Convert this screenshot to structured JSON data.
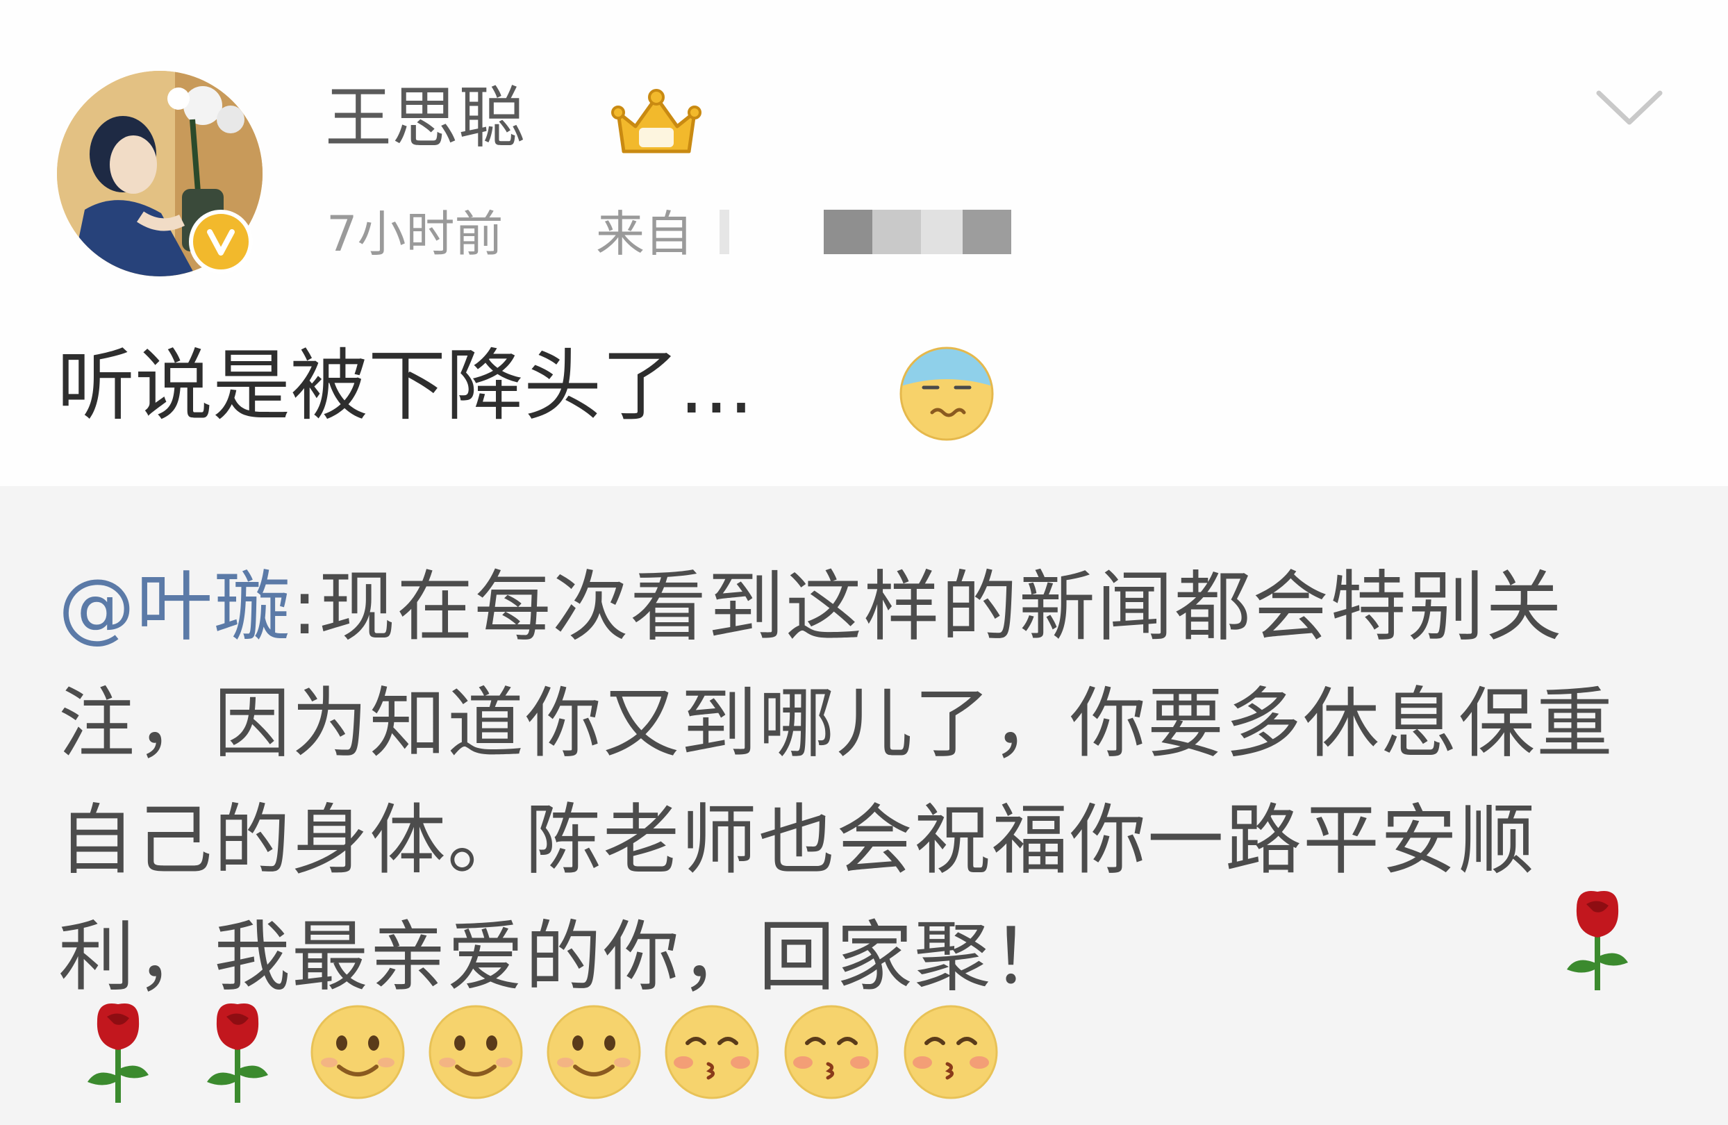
{
  "post": {
    "author": "王思聪",
    "time": "7小时前",
    "source_prefix": "来自",
    "text": "听说是被下降头了...",
    "text_emoji": "cold-sweat-emoji"
  },
  "repost": {
    "mention": "@叶璇",
    "body": ":现在每次看到这样的新闻都会特别关注，因为知道你又到哪儿了，你要多休息保重自己的身体。陈老师也会祝福你一路平安顺利，我最亲爱的你，回家聚！",
    "trailing_emojis": [
      "rose-emoji",
      "rose-emoji",
      "rose-emoji",
      "smile-emoji",
      "smile-emoji",
      "smile-emoji",
      "kiss-emoji",
      "kiss-emoji",
      "kiss-emoji"
    ]
  },
  "colors": {
    "username": "#5a5a5a",
    "meta": "#9a9a9a",
    "mention": "#5b7aa7",
    "repost_bg": "#f4f4f4",
    "vip_gold": "#f2b92c"
  }
}
